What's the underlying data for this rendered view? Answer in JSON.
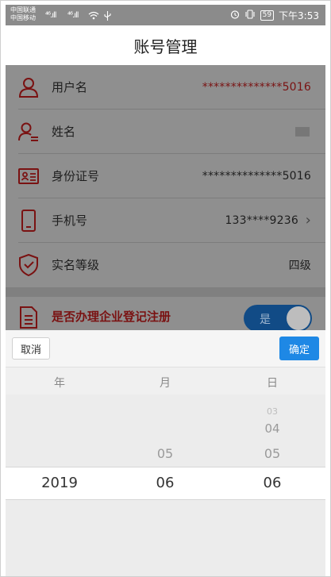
{
  "status_bar": {
    "carrier_lines": "中国联通\n中国移动",
    "signal_1": "⁴⁶.ıll",
    "signal_2": "⁴⁶.ıll",
    "battery": "59",
    "time": "下午3:53"
  },
  "header": {
    "title": "账号管理"
  },
  "rows": [
    {
      "label": "用户名",
      "value": "**************5016",
      "icon": "user-icon"
    },
    {
      "label": "姓名",
      "value": "",
      "icon": "name-card-icon"
    },
    {
      "label": "身份证号",
      "value": "**************5016",
      "icon": "id-card-icon"
    },
    {
      "label": "手机号",
      "value": "133****9236",
      "chevron": "›",
      "icon": "phone-icon"
    },
    {
      "label": "实名等级",
      "value": "四级",
      "icon": "shield-check-icon"
    }
  ],
  "registration": {
    "label": "是否办理企业登记注册",
    "toggle_text": "是",
    "toggle_on": true,
    "icon": "document-icon"
  },
  "picker": {
    "cancel": "取消",
    "confirm": "确定",
    "col_year": "年",
    "col_month": "月",
    "col_day": "日",
    "year_selected": "2019",
    "month_prev": "05",
    "month_selected": "06",
    "day_prev3": "03",
    "day_prev2": "04",
    "day_prev1": "05",
    "day_selected": "06"
  },
  "colors": {
    "accent_red": "#7a1212",
    "toggle_blue": "#114b86",
    "confirm_blue": "#1e88e5"
  }
}
